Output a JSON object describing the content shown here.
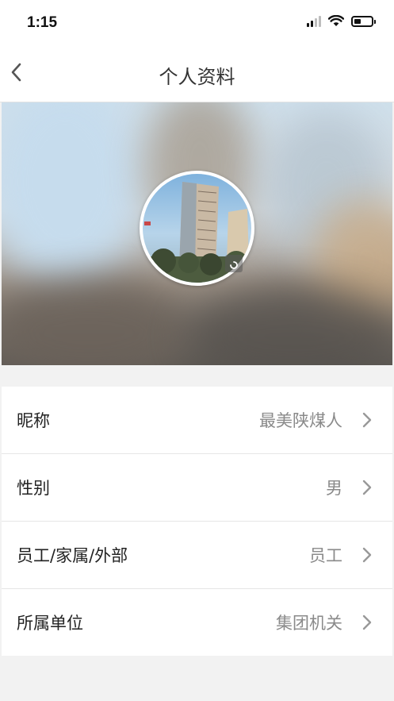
{
  "status_bar": {
    "time": "1:15"
  },
  "nav": {
    "title": "个人资料"
  },
  "profile": {
    "rows": [
      {
        "label": "昵称",
        "value": "最美陕煤人"
      },
      {
        "label": "性别",
        "value": "男"
      },
      {
        "label": "员工/家属/外部",
        "value": "员工"
      },
      {
        "label": "所属单位",
        "value": "集团机关"
      }
    ]
  },
  "icons": {
    "back": "chevron-left-icon",
    "row_arrow": "chevron-right-icon",
    "camera": "camera-icon",
    "signal": "cellular-signal-icon",
    "wifi": "wifi-icon",
    "battery": "battery-icon"
  },
  "colors": {
    "background": "#f2f2f2",
    "value_text": "#8a8a8a",
    "chevron": "#999999"
  }
}
